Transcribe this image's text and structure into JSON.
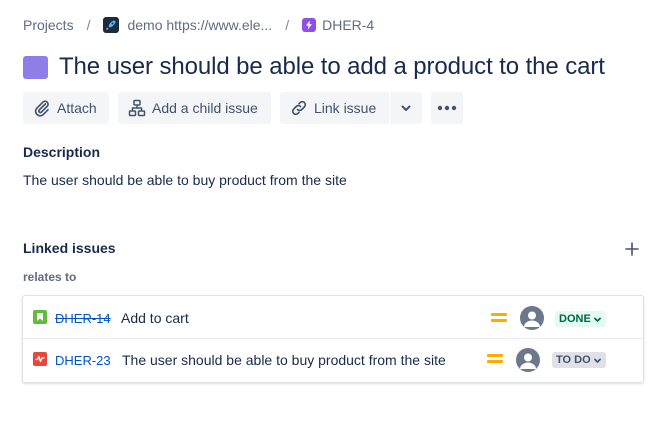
{
  "breadcrumb": {
    "projects": "Projects",
    "separator": "/",
    "project": "demo https://www.ele...",
    "issue_key": "DHER-4"
  },
  "issue": {
    "title": "The user should be able to add a product to the cart",
    "type_color": "#8f7ee7"
  },
  "toolbar": {
    "attach": "Attach",
    "add_child": "Add a child issue",
    "link_issue": "Link issue"
  },
  "description": {
    "label": "Description",
    "text": "The user should be able to buy product from the site"
  },
  "linked_issues": {
    "label": "Linked issues",
    "relation": "relates to",
    "items": [
      {
        "key": "DHER-14",
        "summary": "Add to cart",
        "type_icon": "story-icon",
        "priority": "medium",
        "status": "DONE",
        "resolved": true
      },
      {
        "key": "DHER-23",
        "summary": "The user should be able to buy product from the site",
        "type_icon": "bug-icon",
        "priority": "medium",
        "status": "TO DO",
        "resolved": false
      }
    ]
  },
  "colors": {
    "link": "#0052cc",
    "done_bg": "#e3fcef",
    "done_text": "#006644",
    "todo_bg": "#dfe1e6",
    "priority_medium": "#ffab00"
  }
}
